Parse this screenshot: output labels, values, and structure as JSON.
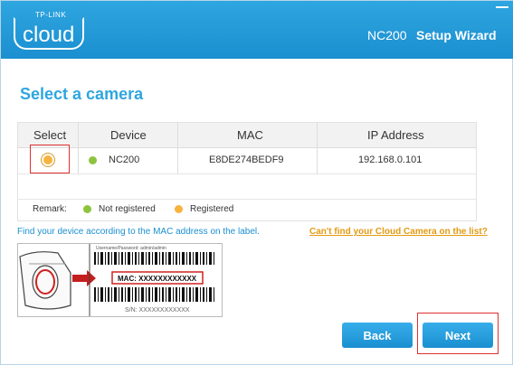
{
  "titlebar": {
    "logo_small": "TP-LINK",
    "logo_big": "cloud",
    "device_model": "NC200",
    "wizard_title": "Setup Wizard"
  },
  "page": {
    "heading": "Select a camera"
  },
  "table": {
    "headers": [
      "Select",
      "Device",
      "MAC",
      "IP Address"
    ],
    "rows": [
      {
        "selected": true,
        "status": "not-registered",
        "device": "NC200",
        "mac": "E8DE274BEDF9",
        "ip": "192.168.0.101"
      }
    ],
    "remark": {
      "label": "Remark:",
      "not_registered": "Not registered",
      "registered": "Registered"
    }
  },
  "help": {
    "find_text": "Find your device according to the MAC address on the label.",
    "cant_find_link": "Can't find your Cloud Camera on the list?"
  },
  "label_image": {
    "credentials": "Username/Password: admin/admin",
    "mac_label": "MAC: XXXXXXXXXXXX",
    "sn_label": "S/N: XXXXXXXXXXXX"
  },
  "buttons": {
    "back": "Back",
    "next": "Next"
  },
  "colors": {
    "accent": "#2ea6e0",
    "not_registered": "#8dc43f",
    "registered": "#f6b43e",
    "highlight": "#e03030"
  }
}
